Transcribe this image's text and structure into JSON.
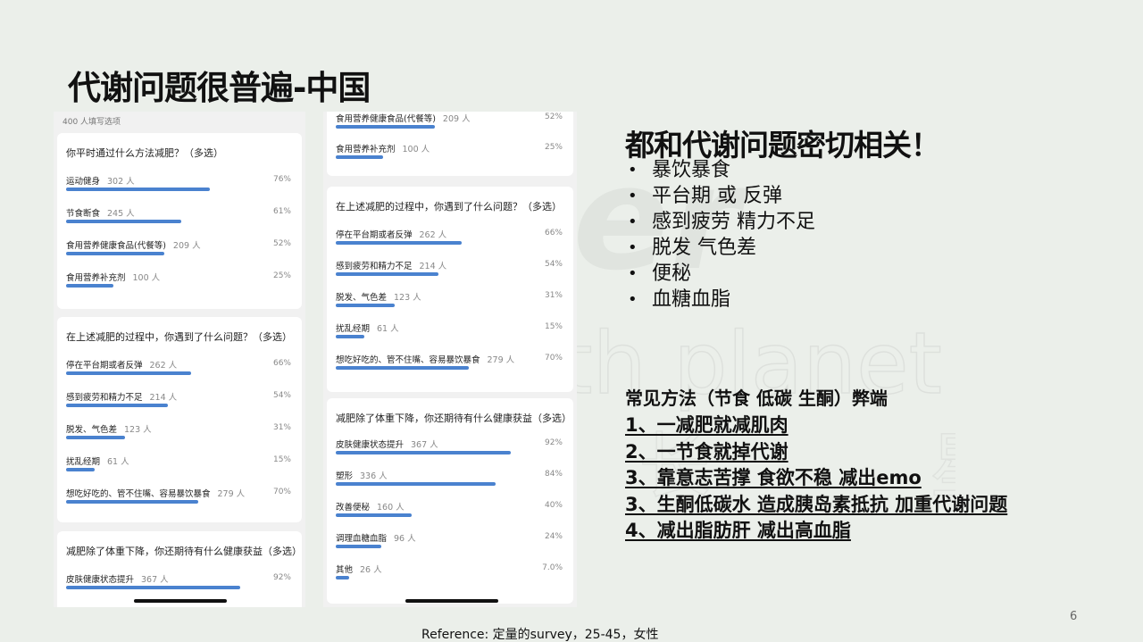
{
  "title": "代谢问题很普遍-中国",
  "watermark": {
    "logo": "CNer",
    "line1": "Growth planet",
    "line2": "成 长 星 球"
  },
  "left_panel": {
    "top_note": "400 人填写选项",
    "cards": [
      {
        "question": "你平时通过什么方法减肥？（多选）",
        "options": [
          {
            "label": "运动健身",
            "count": "302 人",
            "pct": "76%",
            "value": 76
          },
          {
            "label": "节食断食",
            "count": "245 人",
            "pct": "61%",
            "value": 61
          },
          {
            "label": "食用营养健康食品(代餐等)",
            "count": "209 人",
            "pct": "52%",
            "value": 52
          },
          {
            "label": "食用营养补充剂",
            "count": "100 人",
            "pct": "25%",
            "value": 25
          }
        ]
      },
      {
        "question": "在上述减肥的过程中，你遇到了什么问题？（多选）",
        "options": [
          {
            "label": "停在平台期或者反弹",
            "count": "262 人",
            "pct": "66%",
            "value": 66
          },
          {
            "label": "感到疲劳和精力不足",
            "count": "214 人",
            "pct": "54%",
            "value": 54
          },
          {
            "label": "脱发、气色差",
            "count": "123 人",
            "pct": "31%",
            "value": 31
          },
          {
            "label": "扰乱经期",
            "count": "61 人",
            "pct": "15%",
            "value": 15
          },
          {
            "label": "想吃好吃的、管不住嘴、容易暴饮暴食",
            "count": "279 人",
            "pct": "70%",
            "value": 70
          }
        ]
      },
      {
        "question": "减肥除了体重下降，你还期待有什么健康获益（多选）",
        "options": [
          {
            "label": "皮肤健康状态提升",
            "count": "367 人",
            "pct": "92%",
            "value": 92
          }
        ]
      }
    ]
  },
  "right_panel": {
    "cards": [
      {
        "question": "",
        "options": [
          {
            "label": "食用营养健康食品(代餐等)",
            "count": "209 人",
            "pct": "52%",
            "value": 52
          },
          {
            "label": "食用营养补充剂",
            "count": "100 人",
            "pct": "25%",
            "value": 25
          }
        ]
      },
      {
        "question": "在上述减肥的过程中，你遇到了什么问题？（多选）",
        "options": [
          {
            "label": "停在平台期或者反弹",
            "count": "262 人",
            "pct": "66%",
            "value": 66
          },
          {
            "label": "感到疲劳和精力不足",
            "count": "214 人",
            "pct": "54%",
            "value": 54
          },
          {
            "label": "脱发、气色差",
            "count": "123 人",
            "pct": "31%",
            "value": 31
          },
          {
            "label": "扰乱经期",
            "count": "61 人",
            "pct": "15%",
            "value": 15
          },
          {
            "label": "想吃好吃的、管不住嘴、容易暴饮暴食",
            "count": "279 人",
            "pct": "70%",
            "value": 70
          }
        ]
      },
      {
        "question": "减肥除了体重下降，你还期待有什么健康获益（多选）",
        "options": [
          {
            "label": "皮肤健康状态提升",
            "count": "367 人",
            "pct": "92%",
            "value": 92
          },
          {
            "label": "塑形",
            "count": "336 人",
            "pct": "84%",
            "value": 84
          },
          {
            "label": "改善便秘",
            "count": "160 人",
            "pct": "40%",
            "value": 40
          },
          {
            "label": "调理血糖血脂",
            "count": "96 人",
            "pct": "24%",
            "value": 24
          },
          {
            "label": "其他",
            "count": "26 人",
            "pct": "7.0%",
            "value": 7
          }
        ]
      }
    ]
  },
  "heading": "都和代谢问题密切相关！",
  "bullet_symbol": "•",
  "bullets": [
    "暴饮暴食",
    "平台期 或 反弹",
    "感到疲劳 精力不足",
    "脱发 气色差",
    "便秘",
    "血糖血脂"
  ],
  "methods_title": "常见方法（节食 低碳 生酮）弊端",
  "methods": [
    "1、一减肥就减肌肉",
    "2、一节食就掉代谢",
    "3、靠意志苦撑 食欲不稳 减出emo",
    "3、生酮低碳水 造成胰岛素抵抗 加重代谢问题",
    "4、减出脂肪肝 减出高血脂"
  ],
  "page_number": "6",
  "reference": "Reference: 定量的survey，25-45，女性",
  "colors": {
    "bar": "#4a82cf",
    "background": "#ebefea",
    "card": "#ffffff"
  }
}
